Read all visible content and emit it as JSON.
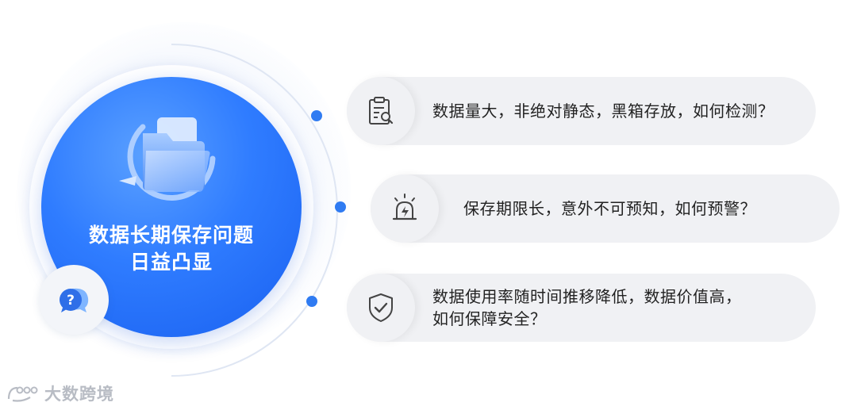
{
  "hero": {
    "title_line1": "数据长期保存问题",
    "title_line2": "日益凸显",
    "icon": "folder-sync-icon"
  },
  "help_icon": "question-chat-icon",
  "cards": [
    {
      "icon": "document-search-icon",
      "lines": [
        "数据量大，非绝对静态，黑箱存放，如何检测？"
      ]
    },
    {
      "icon": "alarm-light-icon",
      "lines": [
        "保存期限长，意外不可预知，如何预警？"
      ]
    },
    {
      "icon": "shield-check-icon",
      "lines": [
        "数据使用率随时间推移降低，数据价值高，",
        "如何保障安全？"
      ]
    }
  ],
  "watermark": {
    "text": "大数跨境",
    "icon": "brand-logo-icon"
  },
  "colors": {
    "accent": "#2f7bf2",
    "card_bg": "#f0f1f4",
    "hero_blue": "#2f7cff"
  }
}
